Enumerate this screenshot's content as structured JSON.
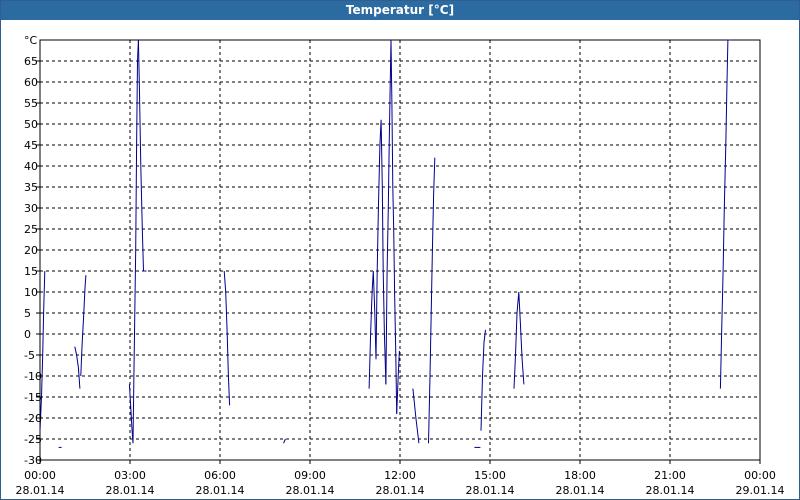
{
  "window": {
    "title": "Temperatur [°C]"
  },
  "chart_data": {
    "type": "line",
    "title": "Temperatur [°C]",
    "ylabel": "°C",
    "xlabel": "",
    "ylim": [
      -30,
      70
    ],
    "xlim": [
      "28.01.14 00:00",
      "29.01.14 00:00"
    ],
    "grid": true,
    "y_ticks": [
      -30,
      -25,
      -20,
      -15,
      -10,
      -5,
      0,
      5,
      10,
      15,
      20,
      25,
      30,
      35,
      40,
      45,
      50,
      55,
      60,
      65
    ],
    "x_ticks": [
      {
        "time": "00:00",
        "date": "28.01.14",
        "hour": 0
      },
      {
        "time": "03:00",
        "date": "28.01.14",
        "hour": 3
      },
      {
        "time": "06:00",
        "date": "28.01.14",
        "hour": 6
      },
      {
        "time": "09:00",
        "date": "28.01.14",
        "hour": 9
      },
      {
        "time": "12:00",
        "date": "28.01.14",
        "hour": 12
      },
      {
        "time": "15:00",
        "date": "28.01.14",
        "hour": 15
      },
      {
        "time": "18:00",
        "date": "28.01.14",
        "hour": 18
      },
      {
        "time": "21:00",
        "date": "28.01.14",
        "hour": 21
      },
      {
        "time": "00:00",
        "date": "29.01.14",
        "hour": 24
      }
    ],
    "line_color": "#00008b",
    "series": [
      {
        "segments": [
          [
            [
              0.0,
              -23
            ],
            [
              0.05,
              -15
            ],
            [
              0.09,
              -5
            ],
            [
              0.12,
              5
            ],
            [
              0.14,
              10
            ],
            [
              0.16,
              15
            ]
          ],
          [
            [
              0.62,
              -27
            ],
            [
              0.72,
              -27
            ]
          ],
          [
            [
              1.16,
              -3
            ],
            [
              1.22,
              -5
            ],
            [
              1.28,
              -8
            ],
            [
              1.33,
              -13
            ]
          ],
          [
            [
              1.36,
              -10
            ],
            [
              1.4,
              -3
            ],
            [
              1.46,
              5
            ],
            [
              1.5,
              11
            ],
            [
              1.53,
              14
            ]
          ],
          [
            [
              2.98,
              -12
            ],
            [
              3.03,
              -18
            ],
            [
              3.06,
              -22
            ],
            [
              3.1,
              -26
            ]
          ],
          [
            [
              3.1,
              -26
            ],
            [
              3.13,
              -10
            ],
            [
              3.16,
              5
            ],
            [
              3.19,
              20
            ],
            [
              3.22,
              45
            ],
            [
              3.25,
              65
            ],
            [
              3.28,
              70
            ]
          ],
          [
            [
              3.28,
              70
            ],
            [
              3.31,
              60
            ],
            [
              3.36,
              40
            ],
            [
              3.41,
              25
            ],
            [
              3.45,
              15
            ],
            [
              3.55,
              15
            ]
          ],
          [
            [
              6.14,
              15
            ],
            [
              6.19,
              10
            ],
            [
              6.24,
              0
            ],
            [
              6.28,
              -10
            ],
            [
              6.32,
              -17
            ]
          ],
          [
            [
              8.12,
              -26
            ],
            [
              8.18,
              -25
            ]
          ],
          [
            [
              10.97,
              -13
            ],
            [
              11.02,
              0
            ],
            [
              11.07,
              10
            ],
            [
              11.11,
              15
            ],
            [
              11.16,
              5
            ],
            [
              11.2,
              -6
            ]
          ],
          [
            [
              11.2,
              -6
            ],
            [
              11.24,
              15
            ],
            [
              11.28,
              30
            ],
            [
              11.33,
              45
            ],
            [
              11.37,
              51
            ],
            [
              11.41,
              35
            ],
            [
              11.44,
              15
            ],
            [
              11.48,
              0
            ],
            [
              11.53,
              -12
            ]
          ],
          [
            [
              11.53,
              -12
            ],
            [
              11.57,
              15
            ],
            [
              11.61,
              30
            ],
            [
              11.64,
              45
            ],
            [
              11.67,
              58
            ],
            [
              11.7,
              70
            ]
          ],
          [
            [
              11.7,
              70
            ],
            [
              11.73,
              55
            ],
            [
              11.76,
              35
            ],
            [
              11.79,
              25
            ],
            [
              11.82,
              10
            ],
            [
              11.86,
              -5
            ],
            [
              11.89,
              -19
            ]
          ],
          [
            [
              11.89,
              -19
            ],
            [
              11.94,
              -10
            ],
            [
              11.98,
              -4
            ]
          ],
          [
            [
              12.43,
              -13
            ],
            [
              12.53,
              -20
            ],
            [
              12.63,
              -26
            ]
          ],
          [
            [
              12.95,
              -26
            ],
            [
              13.0,
              -10
            ],
            [
              13.04,
              5
            ],
            [
              13.08,
              20
            ],
            [
              13.12,
              33
            ],
            [
              13.16,
              42
            ]
          ],
          [
            [
              14.48,
              -27
            ],
            [
              14.68,
              -27
            ]
          ],
          [
            [
              14.7,
              -23
            ],
            [
              14.75,
              -10
            ],
            [
              14.8,
              -2
            ],
            [
              14.85,
              1
            ]
          ],
          [
            [
              15.8,
              -13
            ],
            [
              15.85,
              -5
            ],
            [
              15.9,
              5
            ],
            [
              15.96,
              10
            ],
            [
              16.01,
              3
            ],
            [
              16.07,
              -6
            ],
            [
              16.13,
              -12
            ]
          ],
          [
            [
              22.68,
              -13
            ],
            [
              22.72,
              0
            ],
            [
              22.77,
              15
            ],
            [
              22.81,
              30
            ],
            [
              22.86,
              45
            ],
            [
              22.9,
              60
            ],
            [
              22.93,
              70
            ],
            [
              23.04,
              70
            ]
          ]
        ]
      }
    ]
  }
}
